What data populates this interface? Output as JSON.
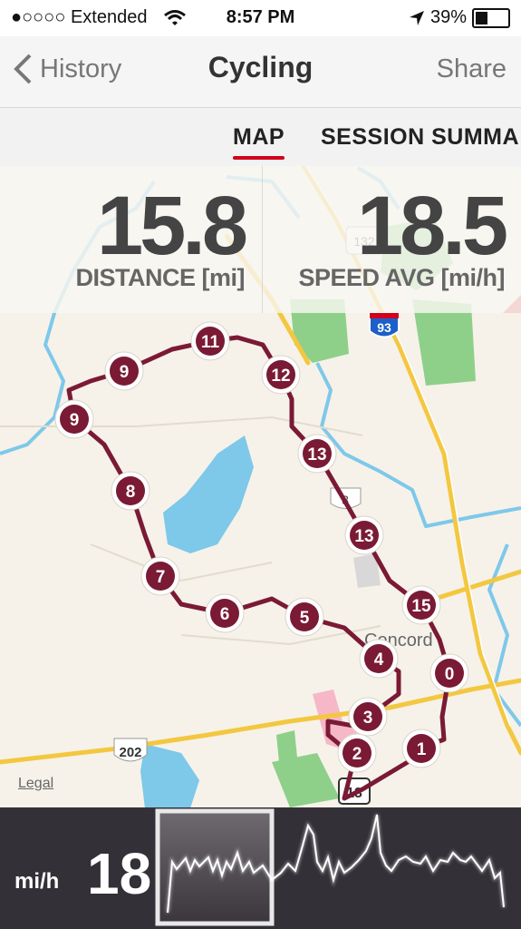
{
  "status_bar": {
    "carrier": "●○○○○ Extended",
    "time": "8:57 PM",
    "battery": "39%",
    "battery_level": 0.39
  },
  "nav": {
    "back_label": "History",
    "title": "Cycling",
    "share_label": "Share"
  },
  "tabs": [
    {
      "label": "MAP",
      "active": true
    },
    {
      "label": "SESSION SUMMA",
      "active": false
    }
  ],
  "stats": {
    "distance_value": "15.8",
    "distance_label": "DISTANCE [mi]",
    "speed_value": "18.5",
    "speed_label": "SPEED AVG [mi/h]"
  },
  "map": {
    "route_color": "#7a1a35",
    "markers": [
      "11",
      "9",
      "12",
      "9",
      "13",
      "8",
      "13",
      "7",
      "15",
      "6",
      "5",
      "4",
      "0",
      "3",
      "1",
      "2"
    ],
    "place_labels": [
      "Concord"
    ],
    "road_shields": [
      "132",
      "93",
      "3",
      "202",
      "13"
    ],
    "legal": "Legal"
  },
  "bottom": {
    "unit": "mi/h",
    "speed": "18"
  }
}
